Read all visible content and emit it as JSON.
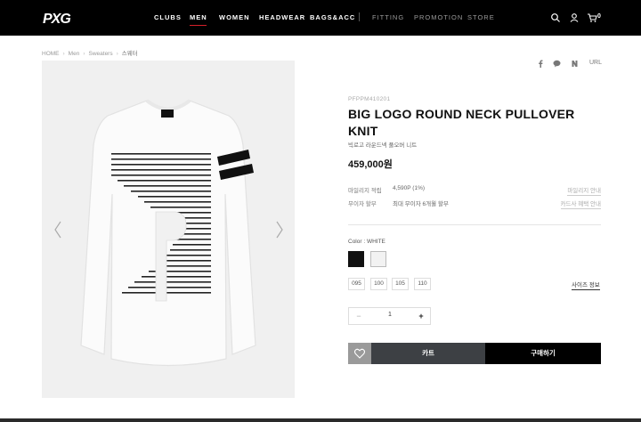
{
  "header": {
    "logo_text": "PXG",
    "nav": [
      {
        "label": "CLUBS"
      },
      {
        "label": "MEN"
      },
      {
        "label": "WOMEN"
      },
      {
        "label": "HEADWEAR"
      },
      {
        "label": "BAGS&ACC"
      },
      {
        "label": "FITTING"
      },
      {
        "label": "PROMOTION"
      },
      {
        "label": "STORE"
      }
    ],
    "active_nav": "MEN",
    "cart_count": "0"
  },
  "breadcrumb": [
    "HOME",
    "Men",
    "Sweaters",
    "스웨터"
  ],
  "share": {
    "url_label": "URL"
  },
  "product": {
    "sku": "PFPPM410201",
    "title": "BIG LOGO ROUND NECK PULLOVER KNIT",
    "subtitle": "빅로고 라운드넥 풀오버 니트",
    "price": "459,000원",
    "info": [
      {
        "label": "마일리지 적립",
        "value": "4,590P (1%)",
        "link": "마일리지 안내"
      },
      {
        "label": "무이자 할부",
        "value": "최대 무이자 6개월 할부",
        "link": "카드사 혜택 안내"
      }
    ],
    "color_label": "Color : WHITE",
    "colors": [
      "#111111",
      "#f2f2f2"
    ],
    "sizes": [
      "095",
      "100",
      "105",
      "110"
    ],
    "size_guide": "사이즈 정보",
    "quantity": "1",
    "cart_label": "카트",
    "buy_label": "구매하기"
  },
  "colors": {
    "header_bg": "#000000",
    "accent": "#d4202a",
    "cart_button": "#3d4044",
    "wish_button": "#9a9a9a"
  }
}
